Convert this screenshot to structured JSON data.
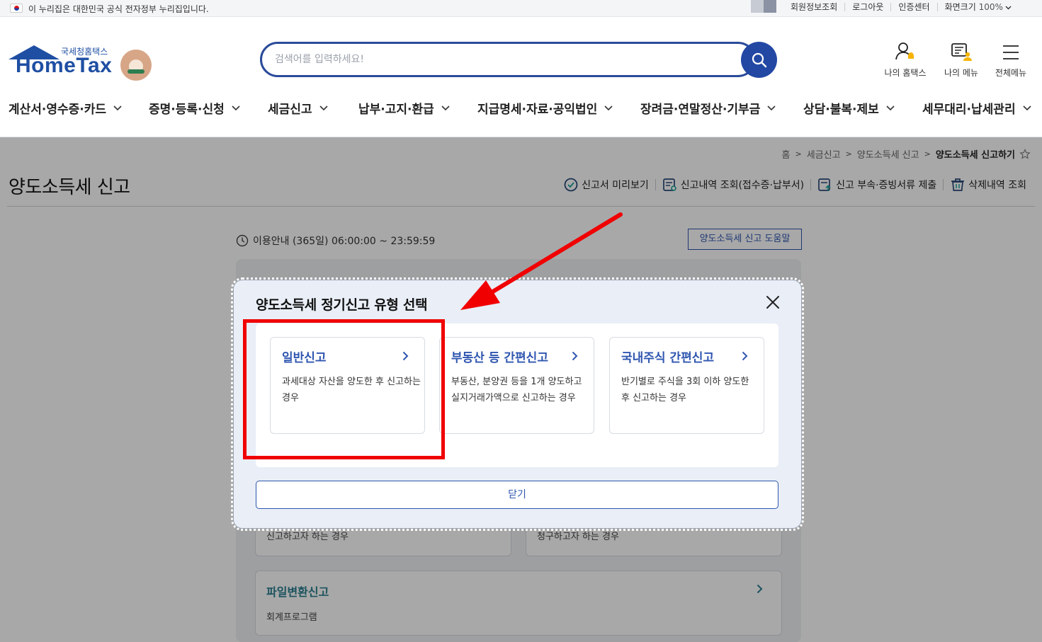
{
  "gov_notice": "이 누리집은 대한민국 공식 전자정부 누리집입니다.",
  "top_links": [
    "회원정보조회",
    "로그아웃",
    "인증센터"
  ],
  "font_size": {
    "label": "화면크기",
    "value": "100%"
  },
  "logo": {
    "org": "국세청홈택스",
    "brand": "HomeTax"
  },
  "search": {
    "placeholder": "검색어를 입력하세요!"
  },
  "header_icons": {
    "my_hometax": "나의 홈택스",
    "my_menu": "나의 메뉴",
    "all_menu": "전체메뉴"
  },
  "gnb": [
    "계산서·영수증·카드",
    "증명·등록·신청",
    "세금신고",
    "납부·고지·환급",
    "지급명세·자료·공익법인",
    "장려금·연말정산·기부금",
    "상담·불복·제보",
    "세무대리·납세관리"
  ],
  "breadcrumb": [
    "홈",
    "세금신고",
    "양도소득세 신고",
    "양도소득세 신고하기"
  ],
  "page_title": "양도소득세 신고",
  "actions": [
    "신고서 미리보기",
    "신고내역 조회(접수증·납부서)",
    "신고 부속·증빙서류 제출",
    "삭제내역 조회"
  ],
  "info": "이용안내 (365일) 06:00:00 ~ 23:59:59",
  "help_button": "양도소득세 신고 도움말",
  "background_cards": {
    "left_desc": "신고하고자 하는 경우",
    "right_desc": "청구하고자 하는 경우",
    "file_title": "파일변환신고",
    "file_desc": "회계프로그램"
  },
  "modal": {
    "title": "양도소득세 정기신고 유형 선택",
    "options": [
      {
        "title": "일반신고",
        "desc": "과세대상 자산을 양도한 후 신고하는 경우"
      },
      {
        "title": "부동산 등 간편신고",
        "desc": "부동산, 분양권 등을 1개 양도하고 실지거래가액으로 신고하는 경우"
      },
      {
        "title": "국내주식 간편신고",
        "desc": "반기별로 주식을 3회 이하 양도한 후 신고하는 경우"
      }
    ],
    "close_label": "닫기"
  },
  "colors": {
    "brand": "#1f4fa3",
    "accent": "#2f56b0",
    "highlight": "#f00000"
  }
}
